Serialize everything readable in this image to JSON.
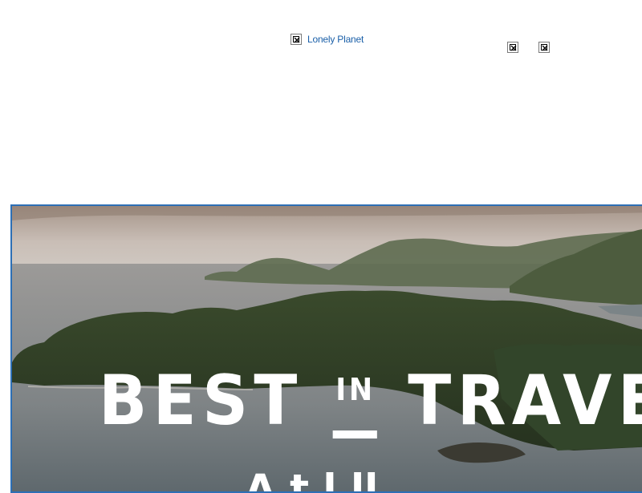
{
  "header": {
    "logo_alt": "Lonely Planet",
    "icons": [
      "broken-image-icon",
      "broken-image-icon",
      "broken-image-icon"
    ]
  },
  "hero": {
    "title_part1": "BEST",
    "title_small": "IN",
    "title_part2": "TRAVE",
    "subtitle_partial": "A t   l  ll"
  },
  "colors": {
    "link": "#1a5fa8",
    "hero_border": "#2d6fb5",
    "title_text": "#ffffff"
  }
}
